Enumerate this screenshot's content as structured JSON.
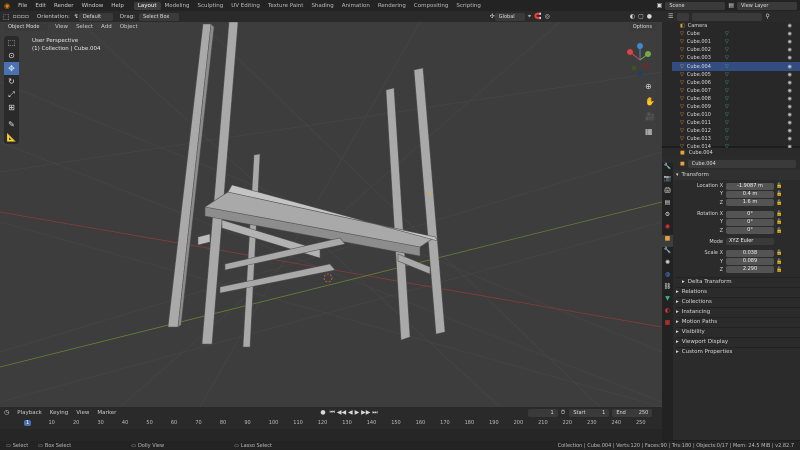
{
  "topbar": {
    "menus": [
      "File",
      "Edit",
      "Render",
      "Window",
      "Help"
    ],
    "workspaces": [
      "Layout",
      "Modeling",
      "Sculpting",
      "UV Editing",
      "Texture Paint",
      "Shading",
      "Animation",
      "Rendering",
      "Compositing",
      "Scripting"
    ],
    "scene_label": "Scene",
    "view_layer_label": "View Layer"
  },
  "vp_header": {
    "orientation_label": "Orientation:",
    "orientation_value": "Default",
    "drag_label": "Drag:",
    "drag_value": "Select Box",
    "transform_value": "Global",
    "options_label": "Options"
  },
  "vp_header2": {
    "mode": "Object Mode",
    "menus": [
      "View",
      "Select",
      "Add",
      "Object"
    ]
  },
  "viewport": {
    "perspective": "User Perspective",
    "collection": "(1) Collection | Cube.004"
  },
  "outliner": {
    "items": [
      "Camera",
      "Cube",
      "Cube.001",
      "Cube.002",
      "Cube.003",
      "Cube.004",
      "Cube.005",
      "Cube.006",
      "Cube.007",
      "Cube.008",
      "Cube.009",
      "Cube.010",
      "Cube.011",
      "Cube.012",
      "Cube.013",
      "Cube.014"
    ],
    "active_index": 5
  },
  "props": {
    "object_name_header": "Cube.004",
    "object_name": "Cube.004",
    "transform_label": "Transform",
    "location_label": "Location X",
    "loc_x": "-1.9087 m",
    "loc_y": "0.4 m",
    "loc_z": "1.6 m",
    "rotation_label": "Rotation X",
    "rot_x": "0°",
    "rot_y": "0°",
    "rot_z": "0°",
    "mode_label": "Mode",
    "mode_value": "XYZ Euler",
    "scale_label": "Scale X",
    "scale_x": "0.038",
    "scale_y": "0.089",
    "scale_z": "2.290",
    "y_label": "Y",
    "z_label": "Z",
    "sections": [
      "Delta Transform",
      "Relations",
      "Collections",
      "Instancing",
      "Motion Paths",
      "Visibility",
      "Viewport Display",
      "Custom Properties"
    ]
  },
  "timeline": {
    "menus": [
      "Playback",
      "Keying",
      "View",
      "Marker"
    ],
    "current_frame": "1",
    "start_label": "Start",
    "start_value": "1",
    "end_label": "End",
    "end_value": "250",
    "ticks": [
      "1",
      "10",
      "20",
      "30",
      "40",
      "50",
      "60",
      "70",
      "80",
      "90",
      "100",
      "110",
      "120",
      "130",
      "140",
      "150",
      "160",
      "170",
      "180",
      "190",
      "200",
      "210",
      "220",
      "230",
      "240",
      "250"
    ]
  },
  "status": {
    "select": "Select",
    "box_select": "Box Select",
    "dolly_view": "Dolly View",
    "lasso_select": "Lasso Select",
    "stats": "Collection | Cube.004 | Verts:120 | Faces:90 | Tris:180 | Objects:0/17 | Mem: 24.5 MiB | v2.82.7"
  }
}
